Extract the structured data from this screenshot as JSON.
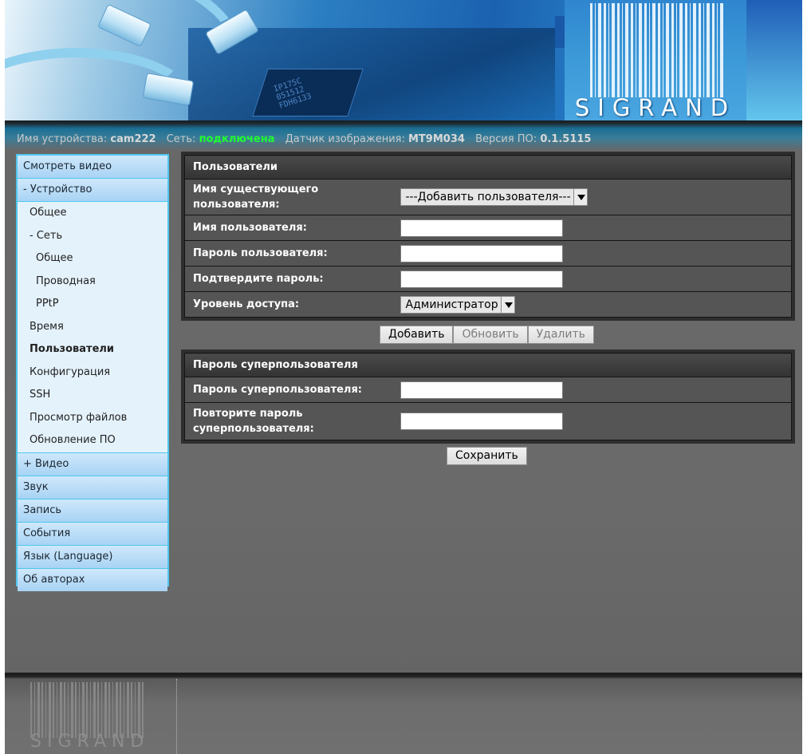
{
  "header": {
    "logo_text": "SIGRAND",
    "chip_text": "IP175C\n051512\nFDH6133"
  },
  "status": {
    "device_name_label": "Имя устройства:",
    "device_name": "cam222",
    "network_label": "Сеть:",
    "network_state": "подключена",
    "sensor_label": "Датчик изображения:",
    "sensor": "MT9M034",
    "firmware_label": "Версия ПО:",
    "firmware": "0.1.5115",
    "network_state_color": "#1fff30"
  },
  "menu": {
    "items": [
      {
        "label": "Смотреть видео"
      },
      {
        "label": "- Устройство"
      },
      {
        "label": "+ Видео"
      },
      {
        "label": "Звук"
      },
      {
        "label": "Запись"
      },
      {
        "label": "События"
      },
      {
        "label": "Язык (Language)"
      },
      {
        "label": "Об авторах"
      }
    ],
    "device_sub": [
      {
        "label": "Общее"
      },
      {
        "label": "- Сеть"
      },
      {
        "label": "Общее"
      },
      {
        "label": "Проводная"
      },
      {
        "label": "PPtP"
      },
      {
        "label": "Время"
      },
      {
        "label": "Пользователи"
      },
      {
        "label": "Конфигурация"
      },
      {
        "label": "SSH"
      },
      {
        "label": "Просмотр файлов"
      },
      {
        "label": "Обновление ПО"
      }
    ]
  },
  "users": {
    "title": "Пользователи",
    "existing_label": "Имя существующего пользователя:",
    "existing_value": "---Добавить пользователя---",
    "username_label": "Имя пользователя:",
    "username_value": "",
    "password_label": "Пароль пользователя:",
    "password_value": "",
    "confirm_label": "Подтвердите пароль:",
    "confirm_value": "",
    "access_label": "Уровень доступа:",
    "access_value": "Администратор",
    "add_button": "Добавить",
    "update_button": "Обновить",
    "delete_button": "Удалить"
  },
  "superuser": {
    "title": "Пароль суперпользователя",
    "password_label": "Пароль суперпользователя:",
    "password_value": "",
    "repeat_label": "Повторите пароль суперпользователя:",
    "repeat_value": "",
    "save_button": "Сохранить"
  },
  "footer": {
    "logo_text": "SIGRAND"
  }
}
